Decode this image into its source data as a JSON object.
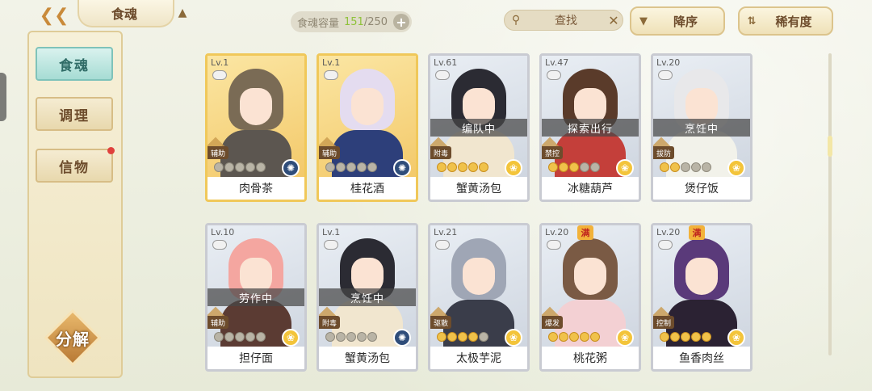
{
  "header": {
    "title": "食魂",
    "back_icon": "back-arrow-icon",
    "capacity_label": "食魂容量",
    "capacity_used": "151",
    "capacity_total": "/250",
    "add_label": "+",
    "search_placeholder": "查找",
    "sort_desc_label": "降序",
    "sort_rarity_label": "稀有度"
  },
  "sidebar": {
    "items": [
      {
        "label": "食魂",
        "active": true
      },
      {
        "label": "调理",
        "active": false
      },
      {
        "label": "信物",
        "active": false,
        "notify": true
      }
    ],
    "decompose_label": "分解"
  },
  "cards": [
    {
      "level": "Lv.1",
      "name": "肉骨茶",
      "role": "辅助",
      "status": "",
      "full": "",
      "stars_on": 0,
      "element": "blue",
      "gold": true,
      "hair": "#7a6b55",
      "body": "#5c5650"
    },
    {
      "level": "Lv.1",
      "name": "桂花酒",
      "role": "辅助",
      "status": "",
      "full": "",
      "stars_on": 0,
      "element": "blue",
      "gold": true,
      "hair": "#e4dcf0",
      "body": "#2d3f7a"
    },
    {
      "level": "Lv.61",
      "name": "蟹黄汤包",
      "role": "附毒",
      "status": "编队中",
      "full": "",
      "stars_on": 5,
      "element": "gold",
      "gold": false,
      "hair": "#2b2b33",
      "body": "#f1e6cf"
    },
    {
      "level": "Lv.47",
      "name": "冰糖葫芦",
      "role": "禁控",
      "status": "探索出行",
      "full": "",
      "stars_on": 3,
      "element": "gold",
      "gold": false,
      "hair": "#5a3b2a",
      "body": "#c43f3a"
    },
    {
      "level": "Lv.20",
      "name": "煲仔饭",
      "role": "拔防",
      "status": "烹饪中",
      "full": "",
      "stars_on": 2,
      "element": "gold",
      "gold": false,
      "hair": "#e8e8ea",
      "body": "#f2f2ea"
    },
    {
      "level": "Lv.10",
      "name": "担仔面",
      "role": "辅助",
      "status": "劳作中",
      "full": "",
      "stars_on": 0,
      "element": "gold",
      "gold": false,
      "hair": "#f4a6a0",
      "body": "#5b3b33"
    },
    {
      "level": "Lv.1",
      "name": "蟹黄汤包",
      "role": "附毒",
      "status": "烹饪中",
      "full": "",
      "stars_on": 0,
      "element": "blue",
      "gold": false,
      "hair": "#2b2b33",
      "body": "#f1e6cf"
    },
    {
      "level": "Lv.21",
      "name": "太极芋泥",
      "role": "驱散",
      "status": "",
      "full": "",
      "stars_on": 4,
      "element": "gold",
      "gold": false,
      "hair": "#9fa6b5",
      "body": "#3a3d4a"
    },
    {
      "level": "Lv.20",
      "name": "桃花粥",
      "role": "爆发",
      "status": "",
      "full": "满",
      "stars_on": 5,
      "element": "gold",
      "gold": false,
      "hair": "#7a5a44",
      "body": "#f3d0d3"
    },
    {
      "level": "Lv.20",
      "name": "鱼香肉丝",
      "role": "控制",
      "status": "",
      "full": "满",
      "stars_on": 5,
      "element": "gold",
      "gold": false,
      "hair": "#5a3a7a",
      "body": "#2b2233"
    }
  ]
}
